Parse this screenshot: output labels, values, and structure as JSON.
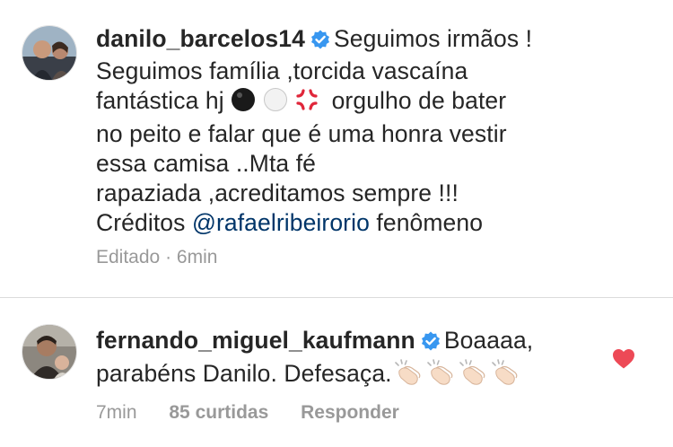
{
  "comments": [
    {
      "username": "danilo_barcelos14",
      "verified": true,
      "lines": [
        "Seguimos irmãos !",
        "Seguimos família ,torcida vascaína",
        "fantástica hj",
        "orgulho de bater",
        "no peito e falar que é uma honra vestir",
        "essa camisa ..Mta fé",
        "rapaziada ,acreditamos sempre !!!",
        "Créditos",
        "@rafaelribeirorio",
        "fenômeno"
      ],
      "emojis": [
        "black-circle",
        "white-circle",
        "anger-symbol"
      ],
      "meta": {
        "edited": "Editado",
        "separator": "·",
        "time": "6min"
      }
    },
    {
      "username": "fernando_miguel_kaufmann",
      "verified": true,
      "lines": [
        "Boaaaa,",
        "parabéns Danilo. Defesaça."
      ],
      "emojis": [
        "clapping-hands",
        "clapping-hands",
        "clapping-hands",
        "clapping-hands"
      ],
      "meta": {
        "time": "7min",
        "likes": "85 curtidas",
        "reply": "Responder"
      },
      "liked": true
    }
  ],
  "colors": {
    "text": "#262626",
    "meta": "#999999",
    "mention": "#003569",
    "verified": "#3897f0",
    "heart": "#ed4956",
    "divider": "#dbdbdb"
  }
}
